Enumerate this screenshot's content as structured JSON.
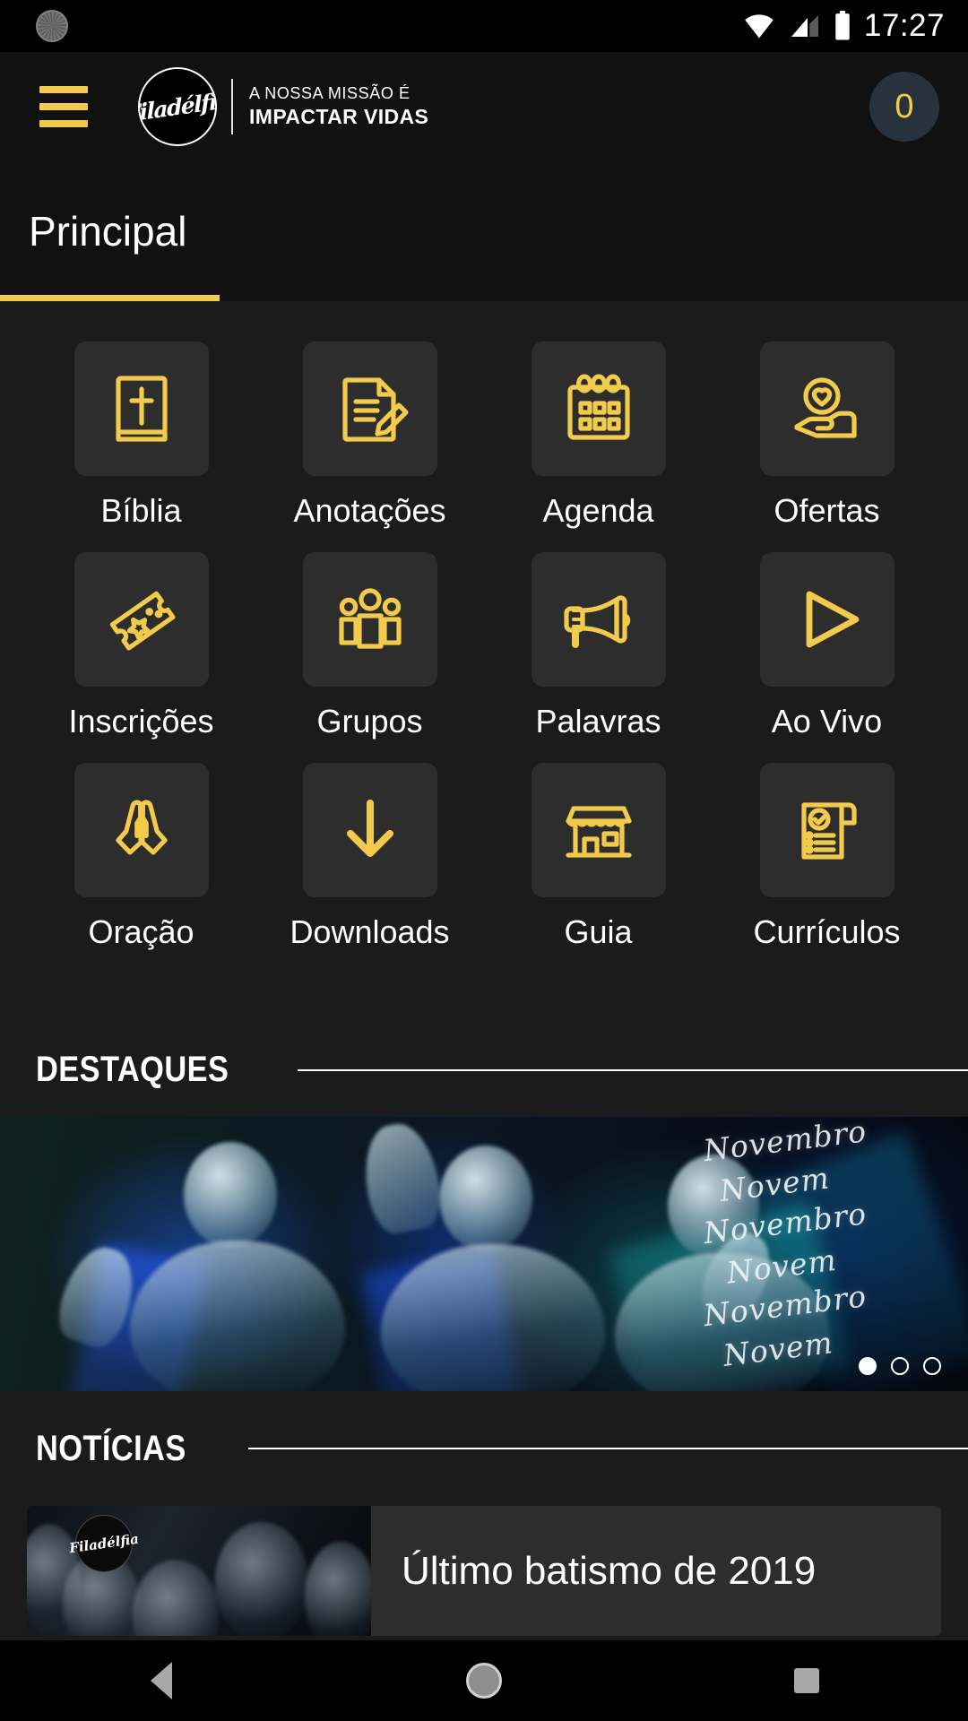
{
  "status_bar": {
    "time": "17:27",
    "icons": [
      "clock-icon",
      "wifi-icon",
      "cellular-signal-icon",
      "battery-icon"
    ]
  },
  "header": {
    "menu_icon": "hamburger-menu-icon",
    "logo_text": "Filadélfia",
    "tagline_line1": "A NOSSA MISSÃO É",
    "tagline_line2": "IMPACTAR VIDAS",
    "counter_value": "0",
    "accent_color": "#f2ca4c",
    "counter_bg": "#27333c"
  },
  "tabs": [
    {
      "label": "Principal",
      "active": true
    }
  ],
  "grid": {
    "items": [
      {
        "label": "Bíblia",
        "icon": "bible-icon"
      },
      {
        "label": "Anotações",
        "icon": "note-pencil-icon"
      },
      {
        "label": "Agenda",
        "icon": "calendar-icon"
      },
      {
        "label": "Ofertas",
        "icon": "hand-heart-icon"
      },
      {
        "label": "Inscrições",
        "icon": "ticket-star-icon"
      },
      {
        "label": "Grupos",
        "icon": "people-group-icon"
      },
      {
        "label": "Palavras",
        "icon": "megaphone-icon"
      },
      {
        "label": "Ao Vivo",
        "icon": "play-triangle-icon"
      },
      {
        "label": "Oração",
        "icon": "praying-hands-icon"
      },
      {
        "label": "Downloads",
        "icon": "download-arrow-icon"
      },
      {
        "label": "Guia",
        "icon": "storefront-icon"
      },
      {
        "label": "Currículos",
        "icon": "resume-check-icon"
      }
    ]
  },
  "destaques": {
    "title": "DESTAQUES",
    "banner_caption_repeat": [
      "Novembro",
      "Novem",
      "Novembro",
      "Novem",
      "Novembro",
      "Novem"
    ],
    "carousel": {
      "total": 3,
      "active_index": 0
    }
  },
  "noticias": {
    "title": "NOTÍCIAS",
    "items": [
      {
        "title": "Último batismo de 2019",
        "thumb_logo": "Filadélfia"
      }
    ]
  },
  "navbar": {
    "back": "back-nav-button",
    "home": "home-nav-button",
    "recents": "recents-nav-button"
  }
}
